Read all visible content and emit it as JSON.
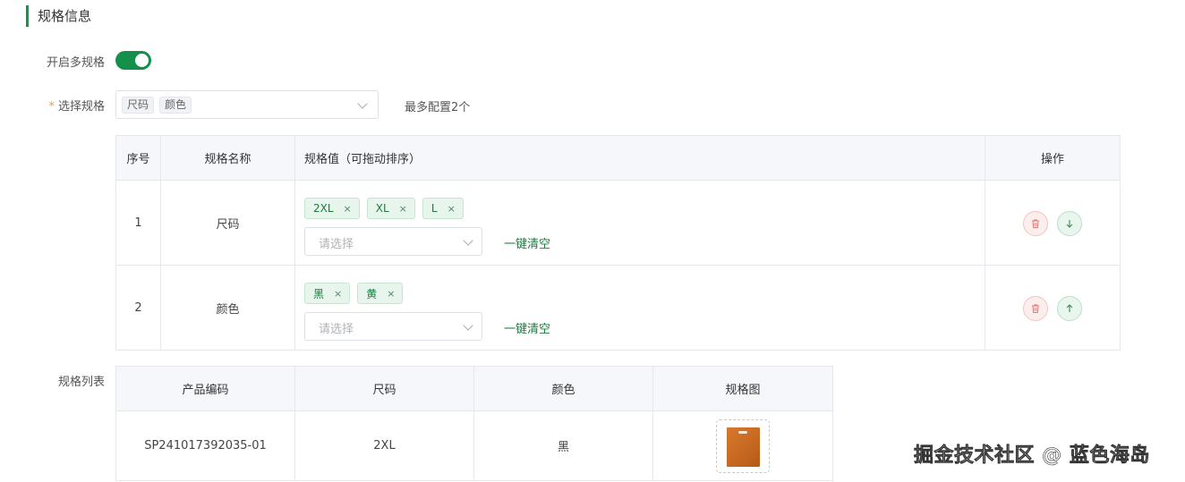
{
  "section": {
    "title": "规格信息"
  },
  "multi_spec": {
    "label": "开启多规格",
    "enabled": true
  },
  "select_spec": {
    "required_mark": "*",
    "label": "选择规格",
    "selected": [
      "尺码",
      "颜色"
    ],
    "hint": "最多配置2个"
  },
  "spec_table": {
    "headers": {
      "index": "序号",
      "name": "规格名称",
      "values": "规格值（可拖动排序）",
      "ops": "操作"
    },
    "rows": [
      {
        "index": "1",
        "name": "尺码",
        "values": [
          "2XL",
          "XL",
          "L"
        ],
        "placeholder": "请选择",
        "clear": "一键清空"
      },
      {
        "index": "2",
        "name": "颜色",
        "values": [
          "黑",
          "黄"
        ],
        "placeholder": "请选择",
        "clear": "一键清空"
      }
    ]
  },
  "spec_list": {
    "label": "规格列表",
    "headers": {
      "code": "产品编码",
      "size": "尺码",
      "color": "颜色",
      "image": "规格图"
    },
    "rows": [
      {
        "code": "SP241017392035-01",
        "size": "2XL",
        "color": "黑"
      }
    ]
  },
  "watermark": "掘金技术社区 @ 蓝色海岛",
  "colors": {
    "accent": "#15904a",
    "tag_bg": "#e8f5ec",
    "danger_bg": "#fdeeee"
  },
  "icons": {
    "delete": "trash-icon",
    "move_down": "arrow-down-icon",
    "move_up": "arrow-up-icon",
    "dropdown": "chevron-down-icon"
  }
}
